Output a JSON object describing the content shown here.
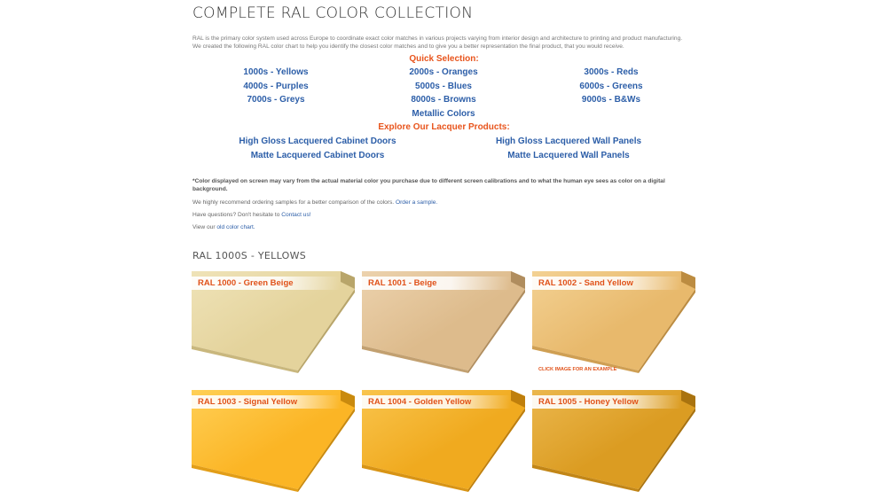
{
  "page_title": "COMPLETE RAL COLOR COLLECTION",
  "intro": {
    "line1": "RAL is the primary color system used across Europe to coordinate exact color matches in various projects varying from interior design and architecture to printing and product manufacturing.",
    "line2": "We created the following RAL color chart to help you identify the closest color matches and to give you a better representation the final product, that you would receive."
  },
  "quick_selection": {
    "heading": "Quick Selection:",
    "links": [
      "1000s - Yellows",
      "2000s - Oranges",
      "3000s - Reds",
      "4000s - Purples",
      "5000s - Blues",
      "6000s - Greens",
      "7000s - Greys",
      "8000s - Browns",
      "9000s - B&Ws",
      "Metallic Colors"
    ]
  },
  "lacquer": {
    "heading": "Explore Our Lacquer Products:",
    "links": [
      "High Gloss Lacquered Cabinet Doors",
      "High Gloss Lacquered Wall Panels",
      "Matte Lacquered Cabinet Doors",
      "Matte Lacquered Wall Panels"
    ]
  },
  "notes": {
    "disclaimer": "*Color displayed on screen may vary from the actual material color you purchase due to different screen calibrations and to what the human eye sees as color on a digital background.",
    "samples_text": "We highly recommend ordering samples for a better comparison of the colors.",
    "samples_link": "Order a sample.",
    "questions_text": "Have questions? Don't hesitate to",
    "questions_link": "Contact us!",
    "old_chart_text": "View our",
    "old_chart_link": "old color chart."
  },
  "section_title": "RAL 1000S - YELLOWS",
  "click_hint": "CLICK IMAGE FOR AN EXAMPLE",
  "swatches": [
    {
      "label": "RAL 1000 - Green Beige",
      "top": "#e4d39c",
      "side": "#b8a56a",
      "front": "#c9b77d",
      "light": "#efe3b8"
    },
    {
      "label": "RAL 1001 - Beige",
      "top": "#ddbb8c",
      "side": "#b08d5e",
      "front": "#c2a070",
      "light": "#ecd2ad"
    },
    {
      "label": "RAL 1002 - Sand Yellow",
      "top": "#e8b96c",
      "side": "#bc8c41",
      "front": "#cf9f53",
      "light": "#f3d193"
    },
    {
      "label": "RAL 1003 - Signal Yellow",
      "top": "#fbb525",
      "side": "#c98a0e",
      "front": "#e29e18",
      "light": "#ffcf55"
    },
    {
      "label": "RAL 1004 - Golden Yellow",
      "top": "#f0aa1f",
      "side": "#bf7f0c",
      "front": "#d89415",
      "light": "#f9c44c"
    },
    {
      "label": "RAL 1005 - Honey Yellow",
      "top": "#db9c22",
      "side": "#a9730f",
      "front": "#c28617",
      "light": "#ebb74d"
    }
  ]
}
